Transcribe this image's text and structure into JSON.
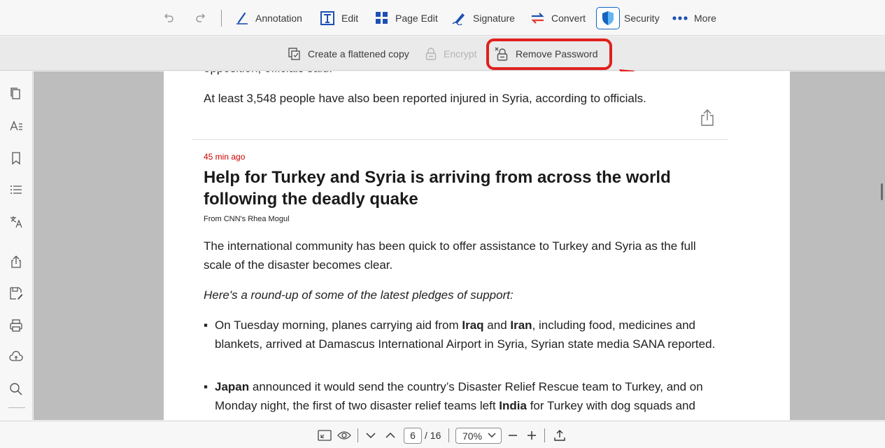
{
  "toolbar": {
    "annotation": "Annotation",
    "edit": "Edit",
    "page_edit": "Page Edit",
    "signature": "Signature",
    "convert": "Convert",
    "security": "Security",
    "more": "More"
  },
  "subbar": {
    "flatten": "Create a flattened copy",
    "encrypt": "Encrypt",
    "remove_password": "Remove Password"
  },
  "document": {
    "cut_line": "opposition, officials said.",
    "intro": "At least 3,548 people have also been reported injured in Syria, according to officials.",
    "time": "45 min ago",
    "headline": "Help for Turkey and Syria is arriving from across the world following the deadly quake",
    "byline": "From CNN's Rhea Mogul",
    "body1": "The international community has been quick to offer assistance to Turkey and Syria as the full scale of the disaster becomes clear.",
    "roundup": "Here's a round-up of some of the latest pledges of support:",
    "bullets": [
      {
        "pre": "On Tuesday morning, planes carrying aid from ",
        "b1": "Iraq",
        "mid": " and ",
        "b2": "Iran",
        "post": ", including food, medicines and blankets, arrived at Damascus International Airport in Syria, Syrian state media SANA reported."
      },
      {
        "b1": "Japan",
        "mid": " announced it would send the country’s Disaster Relief Rescue team to Turkey, and on Monday night, the first of two disaster relief teams left ",
        "b2": "India",
        "post": " for Turkey with dog squads and"
      }
    ]
  },
  "pager": {
    "current_page": "6",
    "total": "/ 16",
    "zoom": "70%"
  },
  "colors": {
    "accent_blue": "#1565c0",
    "convert_red": "#e53935",
    "highlight_red": "#e0201e",
    "time_red": "#cc0000"
  },
  "icons": [
    "undo-icon",
    "redo-icon",
    "annotation-pen-icon",
    "edit-text-icon",
    "page-edit-grid-icon",
    "signature-pen-icon",
    "convert-arrows-icon",
    "security-shield-icon",
    "more-dots-icon",
    "flatten-copy-icon",
    "lock-icon",
    "remove-password-icon",
    "pages-icon",
    "text-format-icon",
    "bookmark-icon",
    "list-icon",
    "translate-icon",
    "share-icon",
    "save-as-icon",
    "print-icon",
    "cloud-upload-icon",
    "search-icon",
    "fit-page-icon",
    "eye-icon",
    "chevron-down-icon",
    "chevron-up-icon",
    "zoom-out-icon",
    "zoom-in-icon",
    "upload-icon"
  ]
}
